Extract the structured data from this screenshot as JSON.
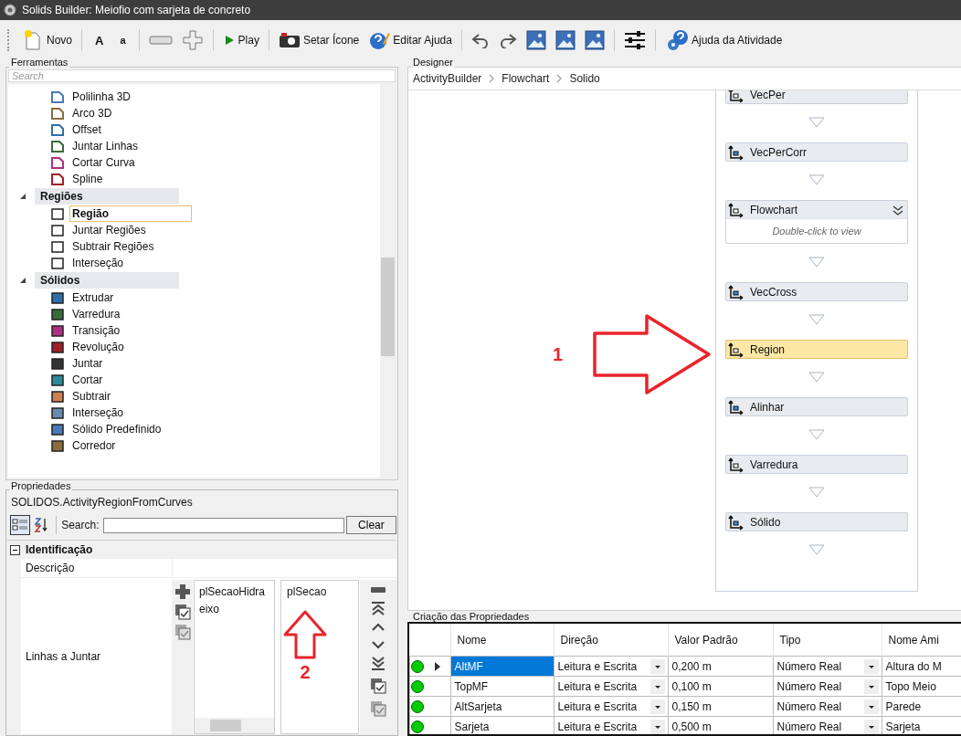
{
  "window": {
    "title": "Solids Builder: Meiofio com sarjeta de concreto"
  },
  "toolbar": [
    [
      {
        "kind": "new",
        "label": "Novo"
      }
    ],
    [
      {
        "kind": "text-large",
        "label": "A"
      },
      {
        "kind": "text-small",
        "label": "a"
      }
    ],
    [
      {
        "kind": "minus"
      },
      {
        "kind": "plus"
      }
    ],
    [
      {
        "kind": "play",
        "label": "Play"
      }
    ],
    [
      {
        "kind": "camera",
        "label": "Setar Ícone"
      },
      {
        "kind": "help-edit",
        "label": "Editar Ajuda"
      }
    ],
    [
      {
        "kind": "undo"
      },
      {
        "kind": "redo"
      },
      {
        "kind": "image"
      },
      {
        "kind": "image"
      },
      {
        "kind": "image"
      }
    ],
    [
      {
        "kind": "sliders"
      }
    ],
    [
      {
        "kind": "help",
        "label": "Ajuda da Atividade"
      }
    ]
  ],
  "tools": {
    "title": "Ferramentas",
    "search": {
      "placeholder": "Search"
    },
    "items": [
      {
        "label": "Polilinha 3D",
        "selected": false
      },
      {
        "label": "Arco 3D",
        "selected": false
      },
      {
        "label": "Offset",
        "selected": false
      },
      {
        "label": "Juntar Linhas",
        "selected": false
      },
      {
        "label": "Cortar Curva",
        "selected": false
      },
      {
        "label": "Spline",
        "selected": false
      }
    ],
    "categories": [
      {
        "label": "Regiões",
        "expanded": true,
        "children": [
          {
            "label": "Região",
            "selected": true
          },
          {
            "label": "Juntar Regiões",
            "selected": false
          },
          {
            "label": "Subtrair Regiões",
            "selected": false
          },
          {
            "label": "Interseção",
            "selected": false
          }
        ]
      },
      {
        "label": "Sólidos",
        "expanded": true,
        "children": [
          {
            "label": "Extrudar",
            "selected": false
          },
          {
            "label": "Varredura",
            "selected": false
          },
          {
            "label": "Transição",
            "selected": false
          },
          {
            "label": "Revolução",
            "selected": false
          },
          {
            "label": "Juntar",
            "selected": false
          },
          {
            "label": "Cortar",
            "selected": false
          },
          {
            "label": "Subtrair",
            "selected": false
          },
          {
            "label": "Interseção",
            "selected": false
          },
          {
            "label": "Sólido Predefinido",
            "selected": false
          },
          {
            "label": "Corredor",
            "selected": false
          }
        ]
      }
    ]
  },
  "properties": {
    "title": "Propriedades",
    "object": "SOLIDOS.ActivityRegionFromCurves",
    "categorized": true,
    "search_label": "Search:",
    "clear": "Clear",
    "category": {
      "label": "Identificação",
      "expanded": true
    },
    "rows": [
      {
        "kind": "text",
        "label": "Descrição"
      },
      {
        "kind": "list-editor",
        "label": "Linhas a Juntar",
        "available": [
          "plSecaoHidra",
          "eixo"
        ],
        "chosen": [
          "plSecao"
        ]
      }
    ],
    "annotation": {
      "label": "2"
    }
  },
  "designer": {
    "title": "Designer",
    "breadcrumb": [
      "ActivityBuilder",
      "Flowchart",
      "Solido"
    ],
    "nodes": [
      {
        "kind": "activity",
        "label": "VecPer",
        "selected": false
      },
      {
        "kind": "activity",
        "label": "VecPerCorr",
        "selected": false
      },
      {
        "kind": "container",
        "label": "Flowchart",
        "hint": "Double-click to view",
        "selected": false
      },
      {
        "kind": "activity",
        "label": "VecCross",
        "selected": false
      },
      {
        "kind": "activity",
        "label": "Region",
        "selected": true
      },
      {
        "kind": "activity",
        "label": "Alinhar",
        "selected": false
      },
      {
        "kind": "activity",
        "label": "Varredura",
        "selected": false
      },
      {
        "kind": "activity",
        "label": "Sólido",
        "selected": false
      }
    ],
    "annotation": {
      "label": "1"
    }
  },
  "property_creation": {
    "title": "Criação das Propriedades",
    "columns": [
      {
        "label": "Nome",
        "kind": "text"
      },
      {
        "label": "Direção",
        "kind": "dropdown"
      },
      {
        "label": "Valor Padrão",
        "kind": "text"
      },
      {
        "label": "Tipo",
        "kind": "dropdown"
      },
      {
        "label": "Nome Ami",
        "kind": "text"
      }
    ],
    "rows": [
      {
        "color": "#00cc00",
        "selected": true,
        "cells": [
          "AltMF",
          "Leitura e Escrita",
          "0,200 m",
          "Número Real",
          "Altura do M"
        ]
      },
      {
        "color": "#00cc00",
        "selected": false,
        "cells": [
          "TopMF",
          "Leitura e Escrita",
          "0,100 m",
          "Número Real",
          "Topo Meio"
        ]
      },
      {
        "color": "#00cc00",
        "selected": false,
        "cells": [
          "AltSarjeta",
          "Leitura e Escrita",
          "0,150 m",
          "Número Real",
          "Parede"
        ]
      },
      {
        "color": "#00cc00",
        "selected": false,
        "cells": [
          "Sarjeta",
          "Leitura e Escrita",
          "0,500 m",
          "Número Real",
          "Sarjeta"
        ]
      }
    ]
  }
}
